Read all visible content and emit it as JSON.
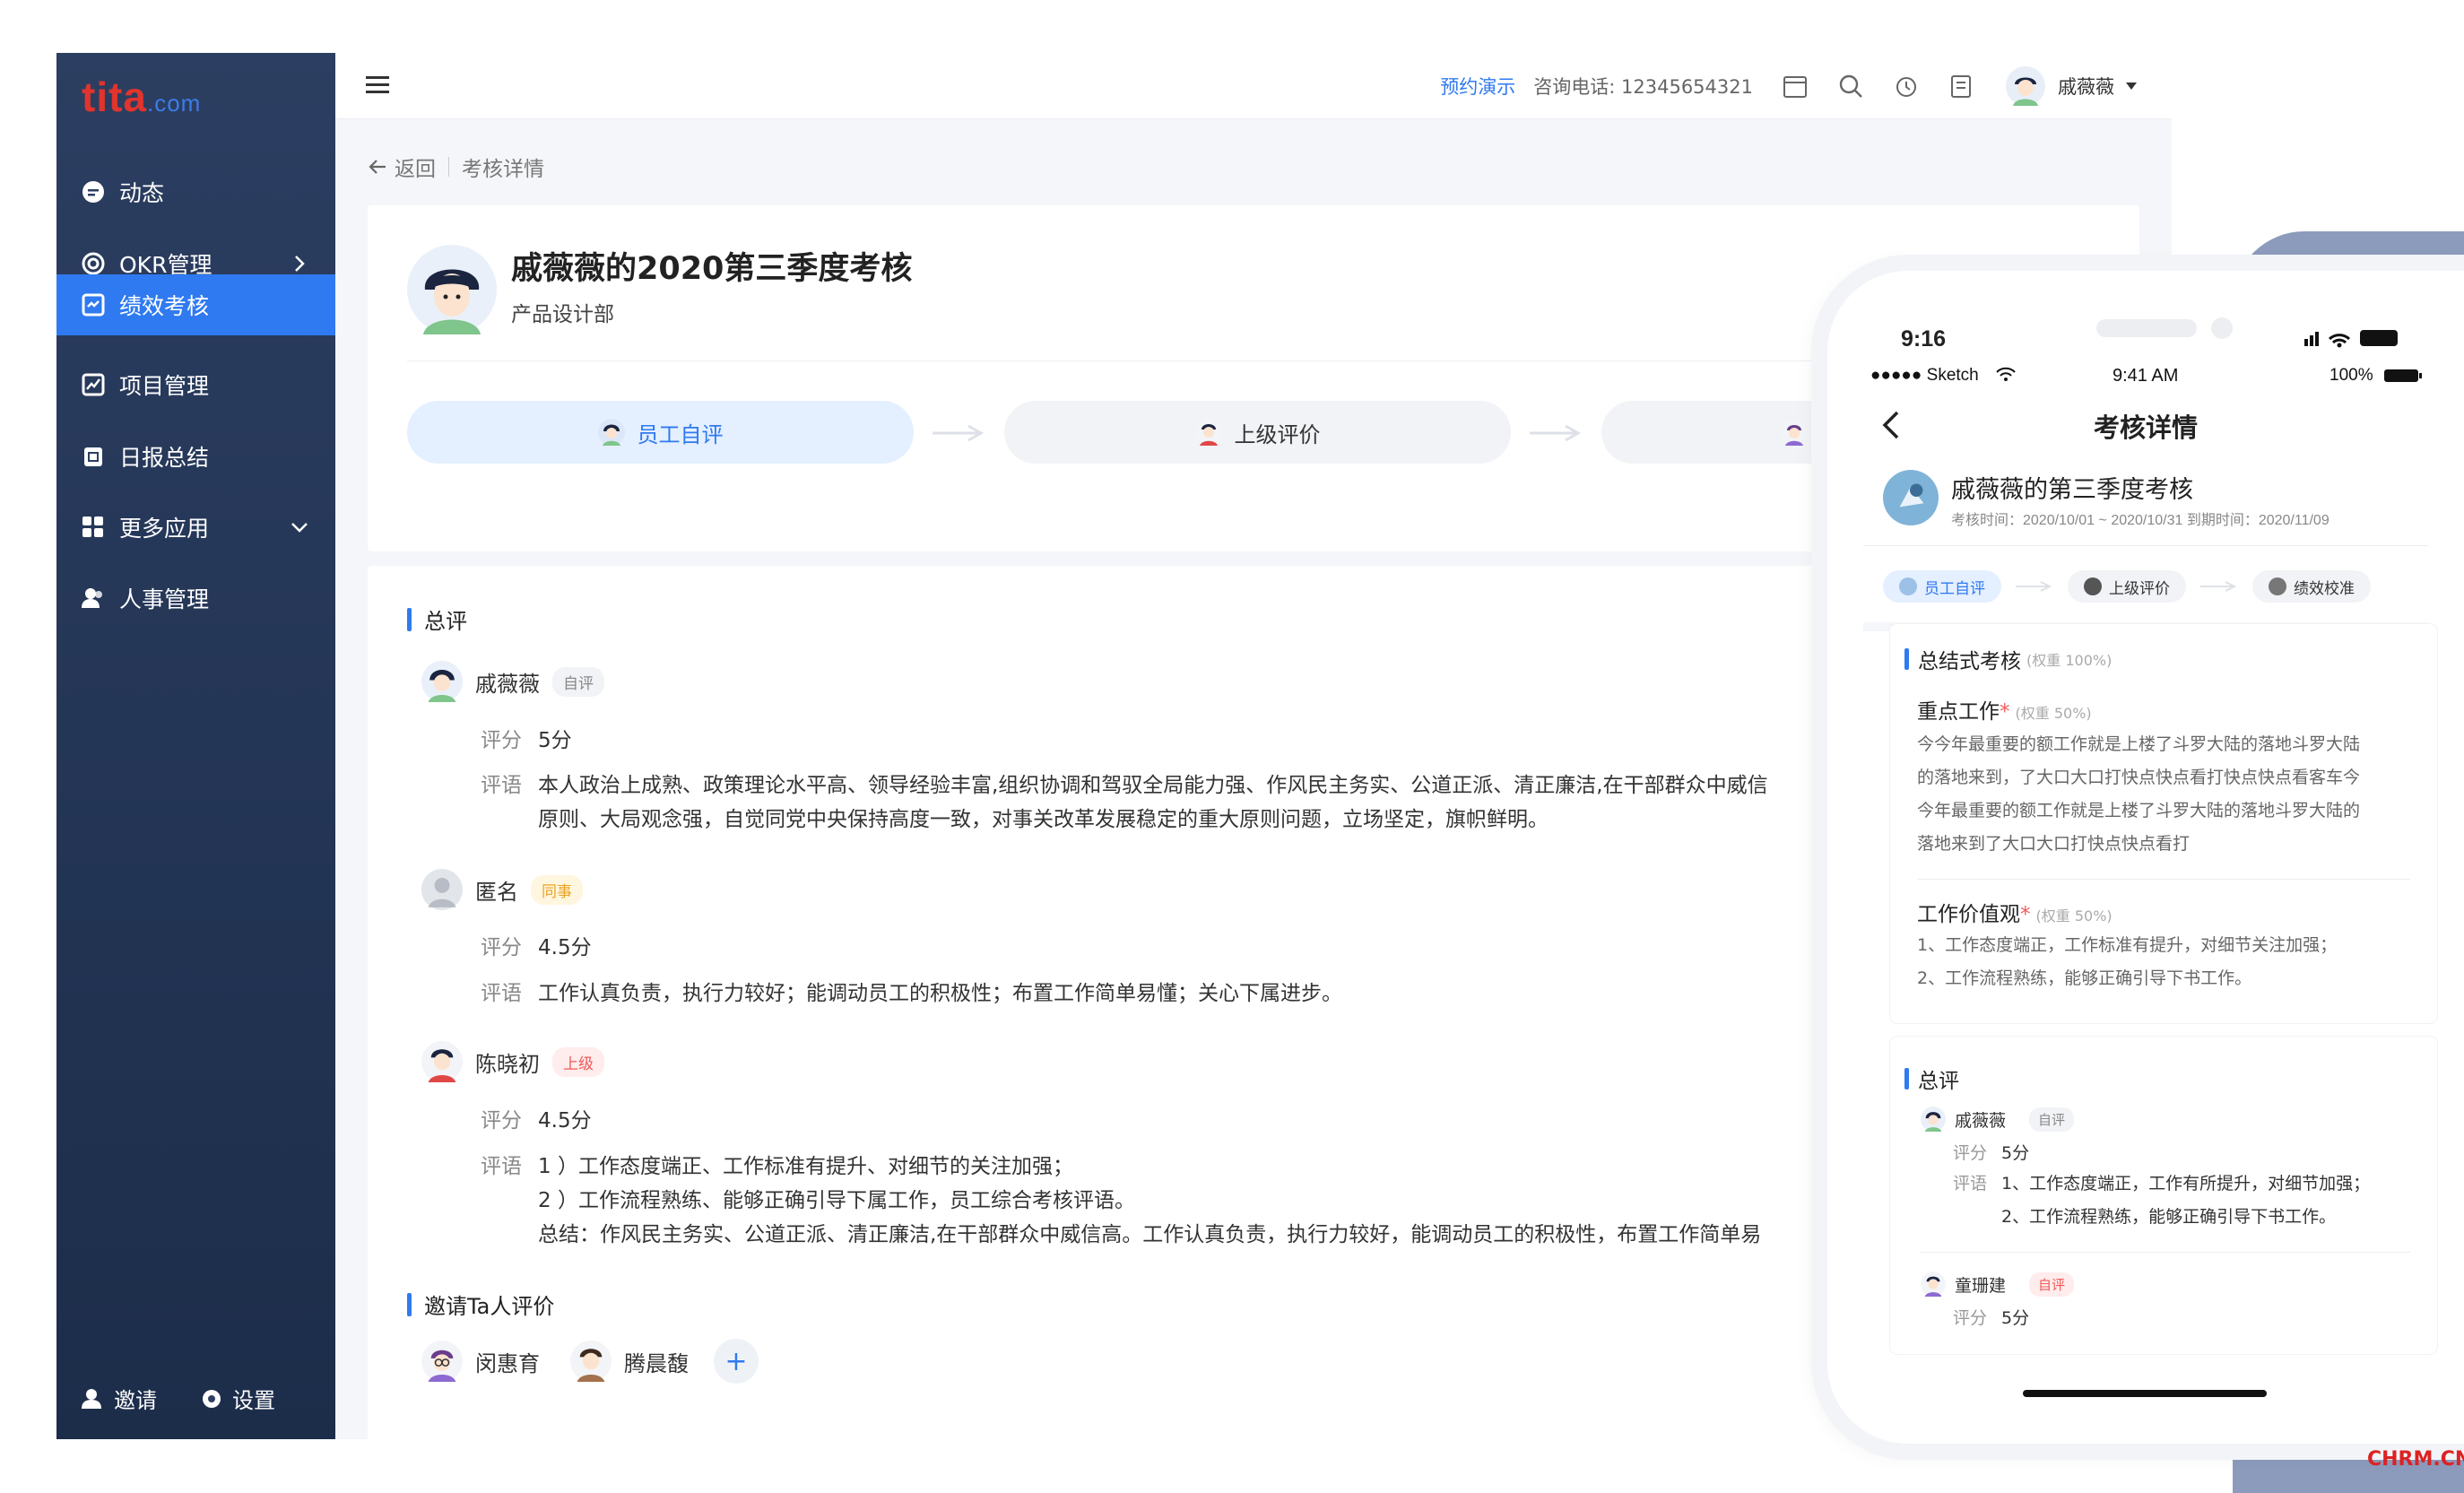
{
  "app": {
    "logo_main": "tita",
    "logo_sub": ".com"
  },
  "sidebar": {
    "items": [
      {
        "label": "动态",
        "icon": "feed-icon"
      },
      {
        "label": "OKR管理",
        "icon": "target-icon"
      },
      {
        "label": "绩效考核",
        "icon": "performance-icon"
      },
      {
        "label": "项目管理",
        "icon": "chart-line-icon"
      },
      {
        "label": "日报总结",
        "icon": "daily-report-icon"
      },
      {
        "label": "更多应用",
        "icon": "apps-grid-icon"
      },
      {
        "label": "人事管理",
        "icon": "people-icon"
      }
    ],
    "footer": {
      "invite": "邀请",
      "settings": "设置"
    }
  },
  "topbar": {
    "demo": "预约演示",
    "phone": "咨询电话: 12345654321",
    "user": "戚薇薇"
  },
  "breadcrumb": {
    "back": "返回",
    "current": "考核详情"
  },
  "header": {
    "title": "戚薇薇的2020第三季度考核",
    "dept": "产品设计部",
    "steps": [
      "员工自评",
      "上级评价"
    ]
  },
  "summary": {
    "title": "总评",
    "score_label": "评分",
    "comment_label": "评语",
    "reviews": [
      {
        "name": "戚薇薇",
        "tag": "自评",
        "score": "5分",
        "comment": "本人政治上成熟、政策理论水平高、领导经验丰富,组织协调和驾驭全局能力强、作风民主务实、公道正派、清正廉洁,在干部群众中威信",
        "comment2": "原则、大局观念强，自觉同党中央保持高度一致，对事关改革发展稳定的重大原则问题，立场坚定，旗帜鲜明。"
      },
      {
        "name": "匿名",
        "tag": "同事",
        "score": "4.5分",
        "comment": "工作认真负责，执行力较好；能调动员工的积极性；布置工作简单易懂；关心下属进步。"
      },
      {
        "name": "陈晓初",
        "tag": "上级",
        "score": "4.5分",
        "comment": "1 ）工作态度端正、工作标准有提升、对细节的关注加强；",
        "comment2": "2 ）工作流程熟练、能够正确引导下属工作，员工综合考核评语。",
        "comment3": "总结：作风民主务实、公道正派、清正廉洁,在干部群众中威信高。工作认真负责，执行力较好，能调动员工的积极性，布置工作简单易"
      }
    ]
  },
  "invite": {
    "title": "邀请Ta人评价",
    "people": [
      "闵惠育",
      "腾晨馥"
    ],
    "add": "+"
  },
  "phone": {
    "time": "9:16",
    "carrier": "●●●●● Sketch",
    "clock": "9:41 AM",
    "battery": "100%",
    "title": "考核详情",
    "eval_title": "戚薇薇的第三季度考核",
    "eval_meta": "考核时间：2020/10/01 ~ 2020/10/31   到期时间：2020/11/09",
    "steps": [
      "员工自评",
      "上级评价",
      "绩效校准"
    ],
    "section1": {
      "title": "总结式考核",
      "weight": "(权重 100%)"
    },
    "key_work": {
      "title": "重点工作",
      "weight": "(权重 50%)",
      "lines": [
        "今今年最重要的额工作就是上楼了斗罗大陆的落地斗罗大陆",
        "的落地来到，了大口大口打快点快点看打快点快点看客车今",
        "今年最重要的额工作就是上楼了斗罗大陆的落地斗罗大陆的",
        "落地来到了大口大口打快点快点看打"
      ]
    },
    "values": {
      "title": "工作价值观",
      "weight": "(权重 50%)",
      "lines": [
        "1、工作态度端正，工作标准有提升，对细节关注加强；",
        "2、工作流程熟练，能够正确引导下书工作。"
      ]
    },
    "summary": {
      "title": "总评",
      "score_label": "评分",
      "comment_label": "评语",
      "r1": {
        "name": "戚薇薇",
        "tag": "自评",
        "score": "5分",
        "line1": "1、工作态度端正，工作有所提升，对细节加强；",
        "line2": "2、工作流程熟练，能够正确引导下书工作。"
      },
      "r2": {
        "name": "童珊建",
        "tag": "自评",
        "score": "5分"
      }
    }
  },
  "watermark": "CHRM.CN"
}
